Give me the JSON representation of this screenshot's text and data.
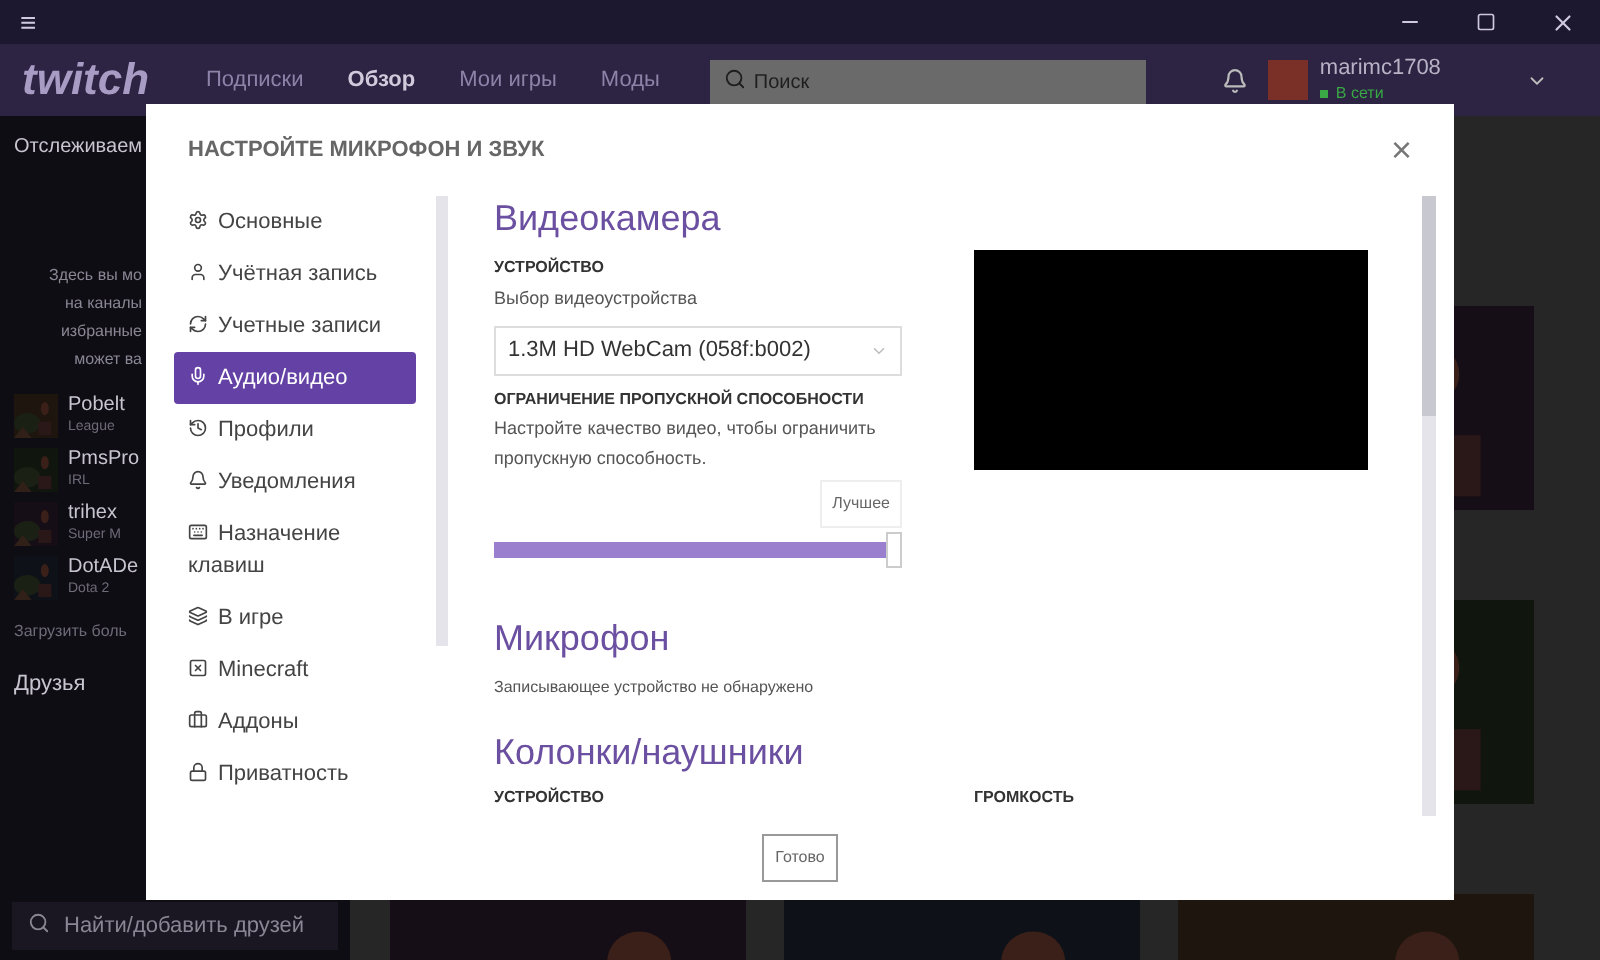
{
  "titlebar": {
    "menu": "≡"
  },
  "nav": {
    "logo": "twitch",
    "links": [
      {
        "label": "Подписки",
        "selected": false
      },
      {
        "label": "Обзор",
        "selected": true
      },
      {
        "label": "Мои игры",
        "selected": false
      },
      {
        "label": "Моды",
        "selected": false
      }
    ],
    "search": {
      "placeholder": "Поиск"
    },
    "user": {
      "name": "marimc1708",
      "status": "В сети"
    }
  },
  "sidebar": {
    "heading": "Отслеживаем",
    "empty_text": [
      "Здесь вы мо",
      "на каналы",
      "избранные",
      "может ва"
    ],
    "channels": [
      {
        "name": "Pobelt",
        "game": "League"
      },
      {
        "name": "PmsPro",
        "game": "IRL"
      },
      {
        "name": "trihex",
        "game": "Super M"
      },
      {
        "name": "DotADe",
        "game": "Dota 2"
      }
    ],
    "load_more": "Загрузить боль",
    "friends": "Друзья",
    "friend_search": {
      "placeholder": "Найти/добавить друзей"
    }
  },
  "dialog": {
    "title": "НАСТРОЙТЕ МИКРОФОН И ЗВУК",
    "close": "×",
    "menu": [
      {
        "label": "Основные",
        "selected": false
      },
      {
        "label": "Учётная запись",
        "selected": false
      },
      {
        "label": "Учетные записи",
        "selected": false
      },
      {
        "label": "Аудио/видео",
        "selected": true
      },
      {
        "label": "Профили",
        "selected": false
      },
      {
        "label": "Уведомления",
        "selected": false
      },
      {
        "label": "Назначение клавиш",
        "selected": false
      },
      {
        "label": "В игре",
        "selected": false
      },
      {
        "label": "Minecraft",
        "selected": false
      },
      {
        "label": "Аддоны",
        "selected": false
      },
      {
        "label": "Приватность",
        "selected": false
      }
    ],
    "camera": {
      "heading": "Видеокамера",
      "device_label": "УСТРОЙСТВО",
      "device_hint": "Выбор видеоустройства",
      "device_value": "1.3M HD WebCam (058f:b002)",
      "bandwidth_label": "ОГРАНИЧЕНИЕ ПРОПУСКНОЙ СПОСОБНОСТИ",
      "bandwidth_hint": "Настройте качество видео, чтобы ограничить пропускную способность.",
      "quality_tooltip": "Лучшее",
      "quality": {
        "level": 1
      }
    },
    "microphone": {
      "heading": "Микрофон",
      "note": "Записывающее устройство не обнаружено"
    },
    "speakers": {
      "heading": "Колонки/наушники",
      "device_label": "УСТРОЙСТВО",
      "volume_label": "ГРОМКОСТЬ"
    },
    "done": "Готово"
  }
}
